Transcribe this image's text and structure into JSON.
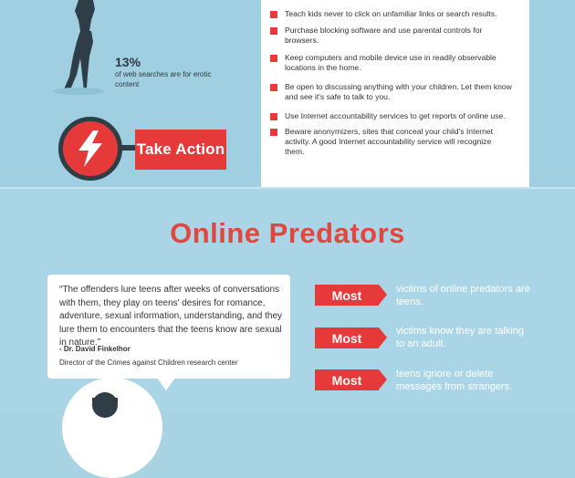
{
  "top_stat": {
    "number": "13%",
    "text": "of web searches are for erotic content"
  },
  "take_action": {
    "label": "Take Action",
    "icon": "lightning-bolt-icon"
  },
  "tips": [
    "Teach kids never to click on unfamiliar links or search results.",
    "Purchase blocking software and use parental controls for browsers.",
    "Keep computers and mobile device use in readily observable locations in the home.",
    "Be open to discussing anything with your children. Let them know and see it's safe to talk to you.",
    "Use Internet accountability services to get reports of online use.",
    "Beware anonymizers, sites that conceal your child's Internet activity. A good Internet accountability service will recognize them."
  ],
  "predators": {
    "title": "Online Predators",
    "quote": "“The offenders lure teens after weeks of conversations with them, they play on teens' desires for romance, adventure, sexual information, understanding, and they lure them to encounters that the teens know are sexual in nature.”",
    "author": "- Dr. David Finkelhor",
    "role": "Director of the Crimes against Children research center",
    "stats": [
      {
        "badge": "Most",
        "text": "victims of online predators are teens."
      },
      {
        "badge": "Most",
        "text": "victims know they are talking to an adult."
      },
      {
        "badge": "Most",
        "text": "teens ignore or delete messages from strangers."
      }
    ]
  },
  "colors": {
    "accent_red": "#e63a3a",
    "dark_navy": "#2e3d46",
    "background_blue": "#a8d3e3"
  }
}
